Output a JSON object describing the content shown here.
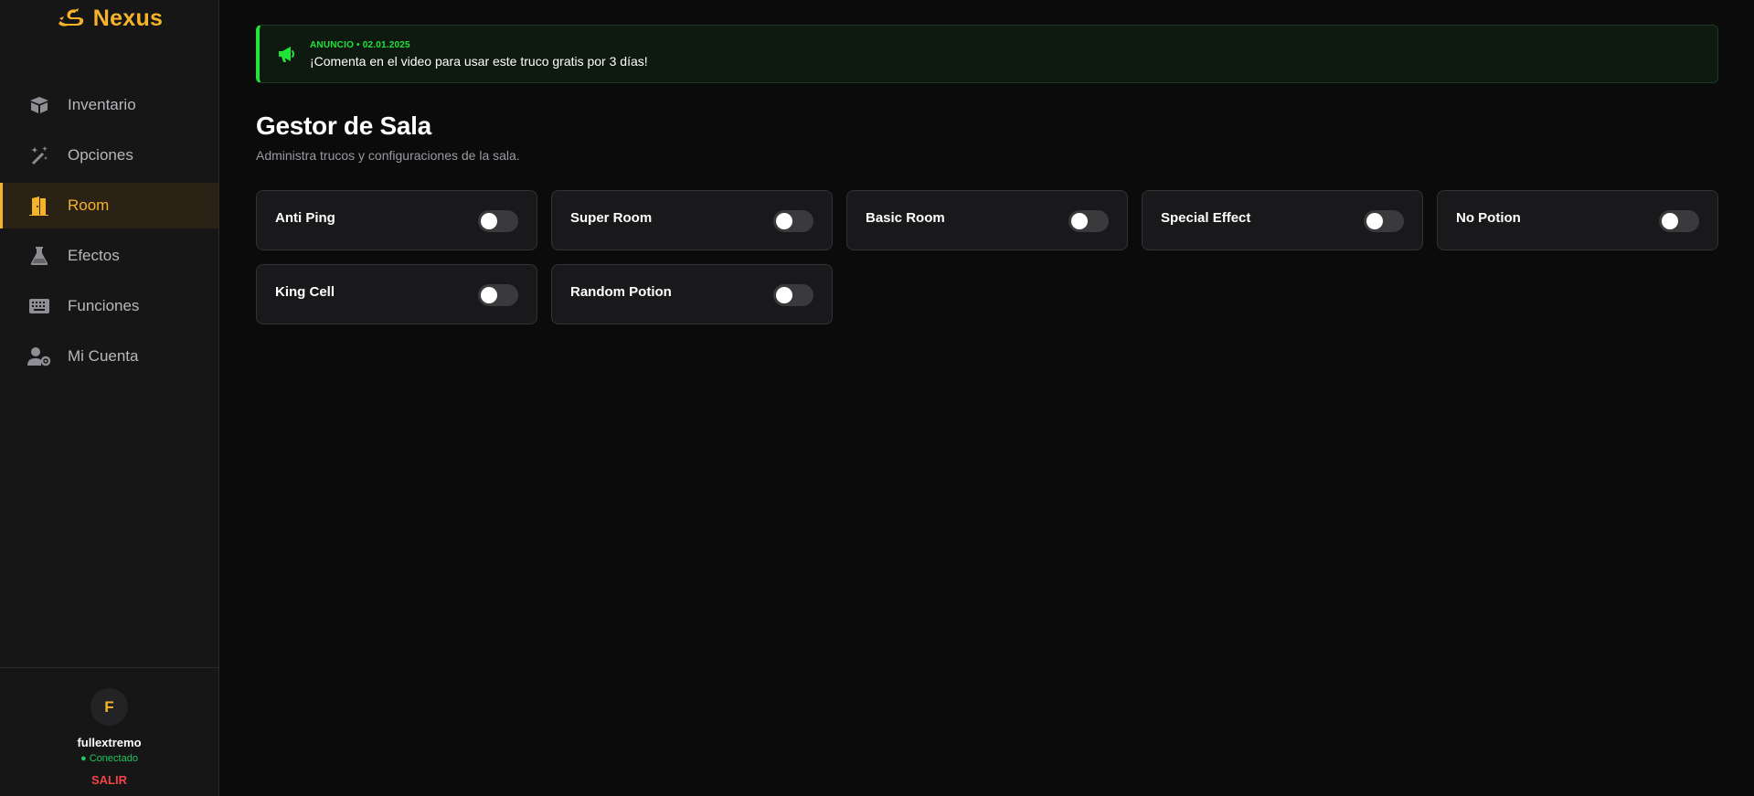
{
  "brand": {
    "name": "Nexus",
    "icon": "nexus-logo-icon",
    "color": "#f5b329"
  },
  "sidebar": {
    "items": [
      {
        "label": "Inventario",
        "icon": "box-icon",
        "active": false
      },
      {
        "label": "Opciones",
        "icon": "magic-wand-icon",
        "active": false
      },
      {
        "label": "Room",
        "icon": "door-icon",
        "active": true
      },
      {
        "label": "Efectos",
        "icon": "flask-icon",
        "active": false
      },
      {
        "label": "Funciones",
        "icon": "keyboard-icon",
        "active": false
      },
      {
        "label": "Mi Cuenta",
        "icon": "user-gear-icon",
        "active": false
      }
    ]
  },
  "user": {
    "initial": "F",
    "name": "fullextremo",
    "status": "● Conectado",
    "logout": "SALIR"
  },
  "announcement": {
    "tag": "ANUNCIO • 02.01.2025",
    "message": "¡Comenta en el video para usar este truco gratis por 3 días!",
    "icon": "megaphone-icon",
    "color": "#22e33a"
  },
  "page": {
    "title": "Gestor de Sala",
    "subtitle": "Administra trucos y configuraciones de la sala."
  },
  "toggles": [
    {
      "label": "Anti Ping",
      "on": false
    },
    {
      "label": "Super Room",
      "on": false
    },
    {
      "label": "Basic Room",
      "on": false
    },
    {
      "label": "Special Effect",
      "on": false
    },
    {
      "label": "No Potion",
      "on": false
    },
    {
      "label": "King Cell",
      "on": false
    },
    {
      "label": "Random Potion",
      "on": false
    }
  ],
  "colors": {
    "accent": "#f5b329",
    "success": "#22c55e",
    "danger": "#ef4444",
    "background": "#0b0b0c",
    "sidebar": "#161617"
  }
}
